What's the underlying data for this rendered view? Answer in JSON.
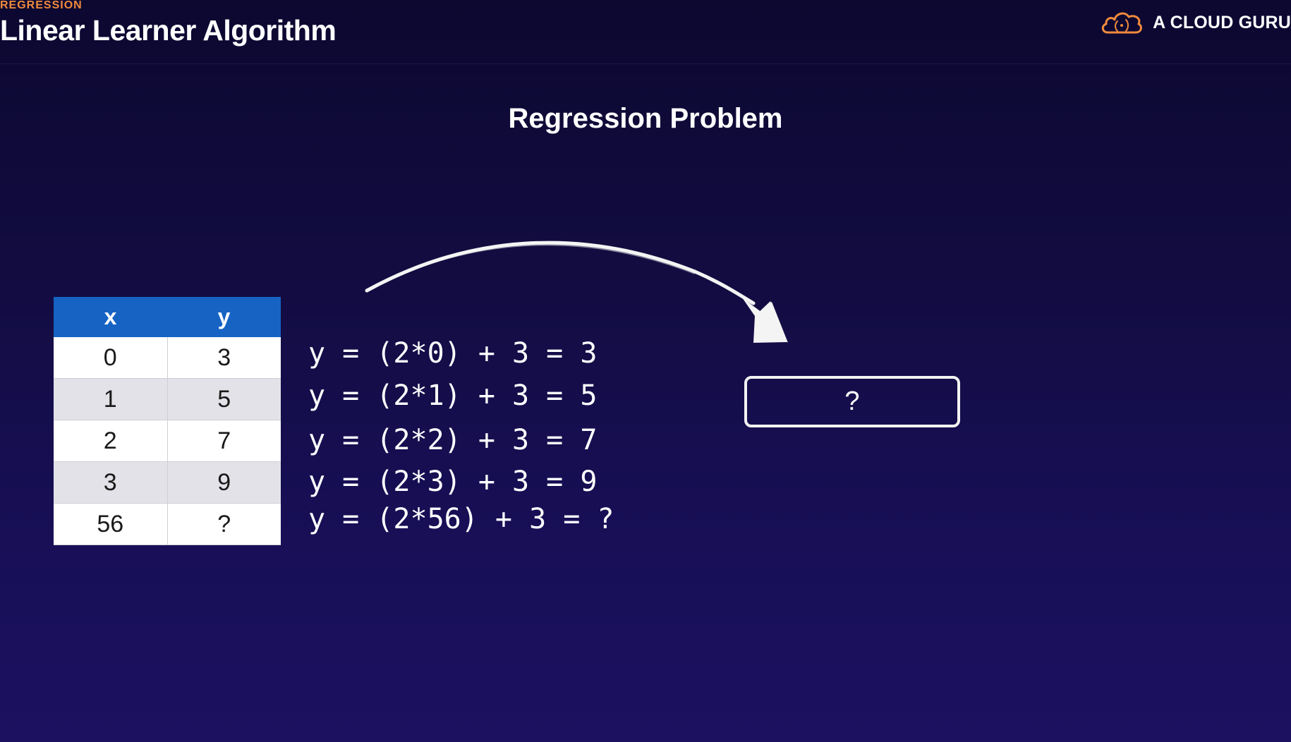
{
  "header": {
    "section_label": "REGRESSION",
    "title": "Linear Learner Algorithm",
    "brand_name": "A CLOUD GURU",
    "brand_icon": "cloud-logo-icon"
  },
  "problem_title": "Regression Problem",
  "table": {
    "columns": [
      "x",
      "y"
    ],
    "rows": [
      [
        "0",
        "3"
      ],
      [
        "1",
        "5"
      ],
      [
        "2",
        "7"
      ],
      [
        "3",
        "9"
      ],
      [
        "56",
        "?"
      ]
    ]
  },
  "equations": [
    "y = (2*0) + 3 = 3",
    "y = (2*1) + 3 = 5",
    "y = (2*2) + 3 = 7",
    "y = (2*3) + 3 = 9",
    "y = (2*56) + 3 = ?"
  ],
  "answer_box": {
    "text": "?"
  },
  "colors": {
    "accent": "#f08a3c",
    "table_header": "#1663c4",
    "background": "#120c40"
  }
}
